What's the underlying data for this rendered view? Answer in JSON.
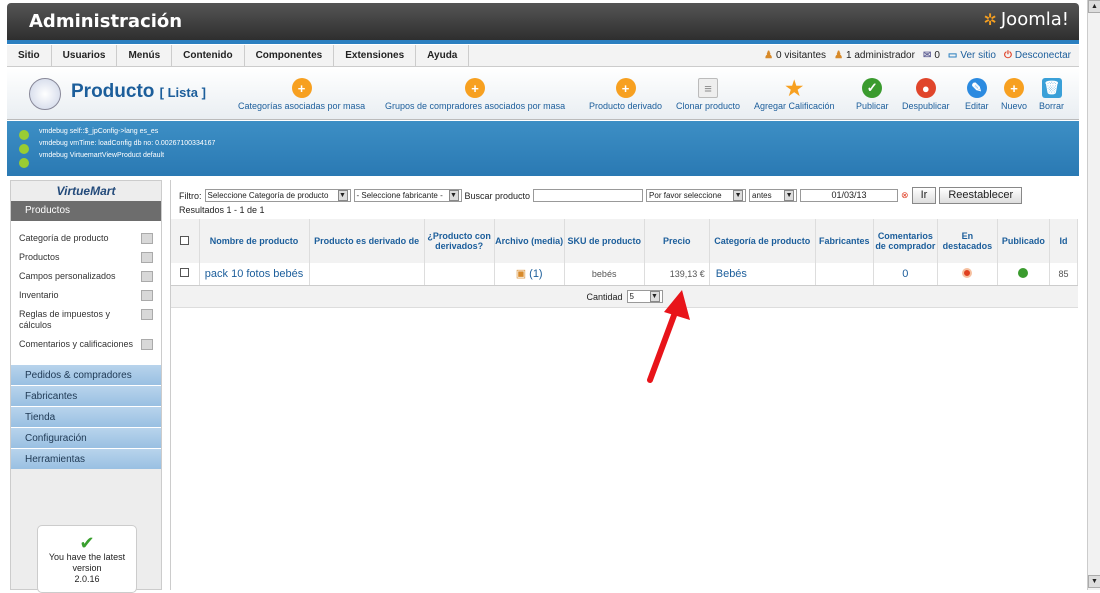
{
  "header": {
    "title": "Administración",
    "brand": "Joomla!"
  },
  "menu": [
    "Sitio",
    "Usuarios",
    "Menús",
    "Contenido",
    "Componentes",
    "Extensiones",
    "Ayuda"
  ],
  "status": {
    "visitors": "0 visitantes",
    "admins": "1 administrador",
    "messages": "0",
    "site": "Ver sitio",
    "logout": "Desconectar"
  },
  "page": {
    "title": "Producto",
    "subtitle": "[ Lista ]"
  },
  "toolbar": [
    "Categorías asociadas por masa",
    "Grupos de compradores asociados por masa",
    "Producto derivado",
    "Clonar producto",
    "Agregar Calificación",
    "Publicar",
    "Despublicar",
    "Editar",
    "Nuevo",
    "Borrar"
  ],
  "debug": [
    "vmdebug self::$_jpConfig->lang es_es",
    "vmdebug vmTime: loadConfig db no: 0.00267100334167",
    "vmdebug VirtuemartViewProduct default"
  ],
  "sidebar": {
    "logo": "VirtueMart",
    "active": "Productos",
    "items": [
      "Categoría de producto",
      "Productos",
      "Campos personalizados",
      "Inventario",
      "Reglas de impuestos y cálculos",
      "Comentarios y calificaciones"
    ],
    "sections": [
      "Pedidos & compradores",
      "Fabricantes",
      "Tienda",
      "Configuración",
      "Herramientas"
    ],
    "version": {
      "line1": "You have the latest",
      "line2": "version",
      "line3": "2.0.16"
    }
  },
  "filter": {
    "label": "Filtro:",
    "category": "Seleccione Categoría de producto",
    "maker": "- Seleccione fabricante -",
    "search_label": "Buscar producto",
    "select": "Por favor seleccione",
    "when": "antes",
    "date": "01/03/13",
    "go": "Ir",
    "reset": "Reestablecer"
  },
  "results": "Resultados 1 - 1 de 1",
  "table": {
    "headers": [
      "Nombre de producto",
      "Producto es derivado de",
      "¿Producto con derivados?",
      "Archivo (media)",
      "SKU de producto",
      "Precio",
      "Categoría de producto",
      "Fabricantes",
      "Comentarios de comprador",
      "En destacados",
      "Publicado",
      "Id"
    ],
    "row": {
      "name": "pack 10 fotos bebés",
      "parent": "",
      "children": "",
      "media": "(1)",
      "sku": "bebés",
      "price": "139,13 €",
      "category": "Bebés",
      "manufacturer": "",
      "reviews": "0",
      "id": "85"
    }
  },
  "pager": {
    "label": "Cantidad",
    "value": "5"
  }
}
